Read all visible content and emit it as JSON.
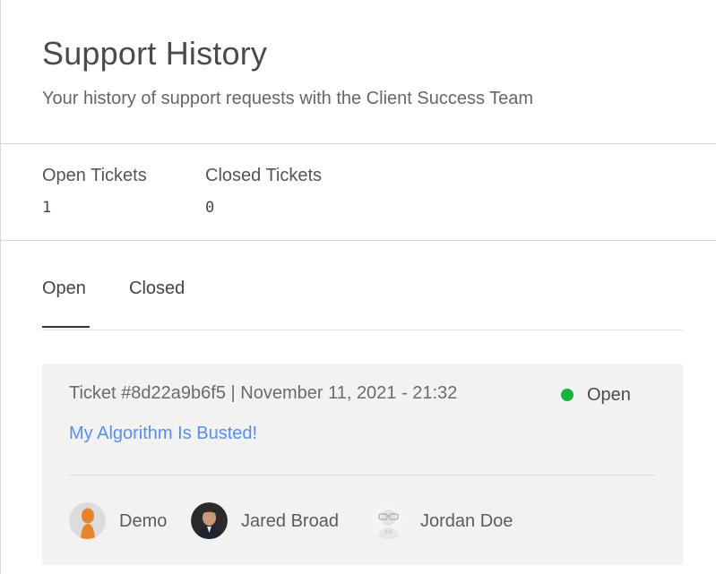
{
  "header": {
    "title": "Support History",
    "subtitle": "Your history of support requests with the Client Success Team"
  },
  "stats": {
    "open_label": "Open Tickets",
    "open_value": "1",
    "closed_label": "Closed Tickets",
    "closed_value": "0"
  },
  "tabs": [
    {
      "label": "Open",
      "active": true
    },
    {
      "label": "Closed",
      "active": false
    }
  ],
  "ticket": {
    "meta": "Ticket #8d22a9b6f5 | November 11, 2021 - 21:32",
    "status": "Open",
    "status_color": "#1ab33a",
    "title": "My Algorithm Is Busted!",
    "participants": [
      {
        "name": "Demo",
        "avatar": "orange-figure-avatar"
      },
      {
        "name": "Jared Broad",
        "avatar": "photo-avatar"
      },
      {
        "name": "Jordan Doe",
        "avatar": "glasses-figure-avatar"
      }
    ]
  },
  "colors": {
    "link": "#5b8def",
    "card_background": "#f2f2f2"
  }
}
